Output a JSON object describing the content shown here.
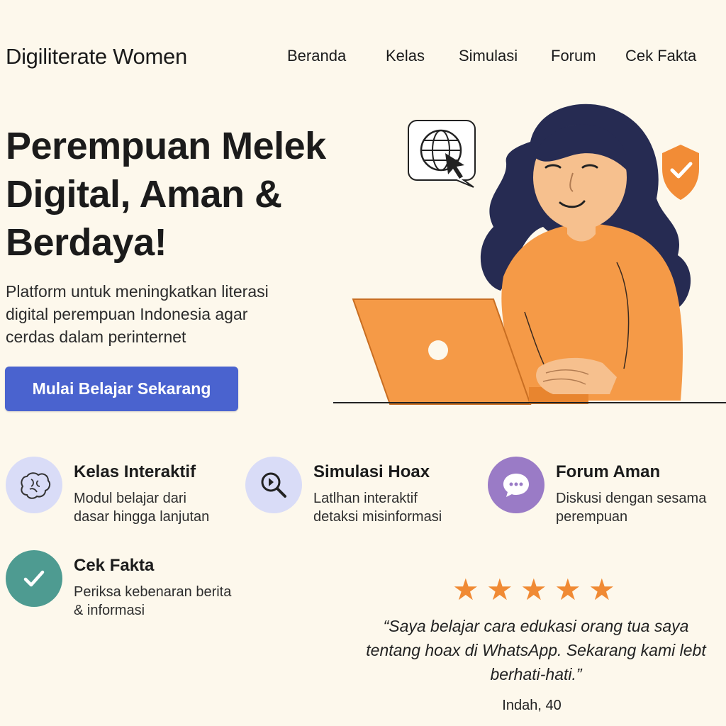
{
  "header": {
    "brand": "Digiliterate Women",
    "nav": [
      "Beranda",
      "Kelas",
      "Simulasi",
      "Forum",
      "Cek Fakta"
    ]
  },
  "hero": {
    "title_lines": [
      "Perempuan Melek",
      "Digital, Aman &",
      "Berdaya!"
    ],
    "subtitle_lines": [
      "Platform untuk meningkatkan literasi",
      "digital perempuan Indonesia agar",
      "cerdas dalam perinternet"
    ],
    "cta_label": "Mulai Belajar Sekarang"
  },
  "illustration": {
    "icons": [
      "globe-cursor-icon",
      "shield-check-icon",
      "woman-laptop-illustration"
    ]
  },
  "features": [
    {
      "title": "Kelas Interaktif",
      "desc_lines": [
        "Modul belajar dari",
        "dasar hingga lanjutan"
      ],
      "icon": "brain-icon",
      "color": "#d9dcf7"
    },
    {
      "title": "Simulasi Hoax",
      "desc_lines": [
        "Latlhan interaktif",
        "detaksi misinformasi"
      ],
      "icon": "magnifier-icon",
      "color": "#d9dcf7"
    },
    {
      "title": "Forum Aman",
      "desc_lines": [
        "Diskusi dengan sesama",
        "perempuan"
      ],
      "icon": "chat-bubble-icon",
      "color": "#9a7bc6"
    },
    {
      "title": "Cek Fakta",
      "desc_lines": [
        "Periksa kebenaran berita",
        "& informasi"
      ],
      "icon": "checkmark-icon",
      "color": "#4e9b91"
    }
  ],
  "testimonial": {
    "rating": 5,
    "quote": "“Saya belajar cara edukasi orang tua saya\ntentang hoax di WhatsApp. Sekarang kami lebt\nberhati-hati.”",
    "author": "Indah, 40"
  },
  "colors": {
    "background": "#fdf8ec",
    "accent_blue": "#4a63cf",
    "accent_orange": "#f59a47",
    "hair": "#262b52"
  }
}
